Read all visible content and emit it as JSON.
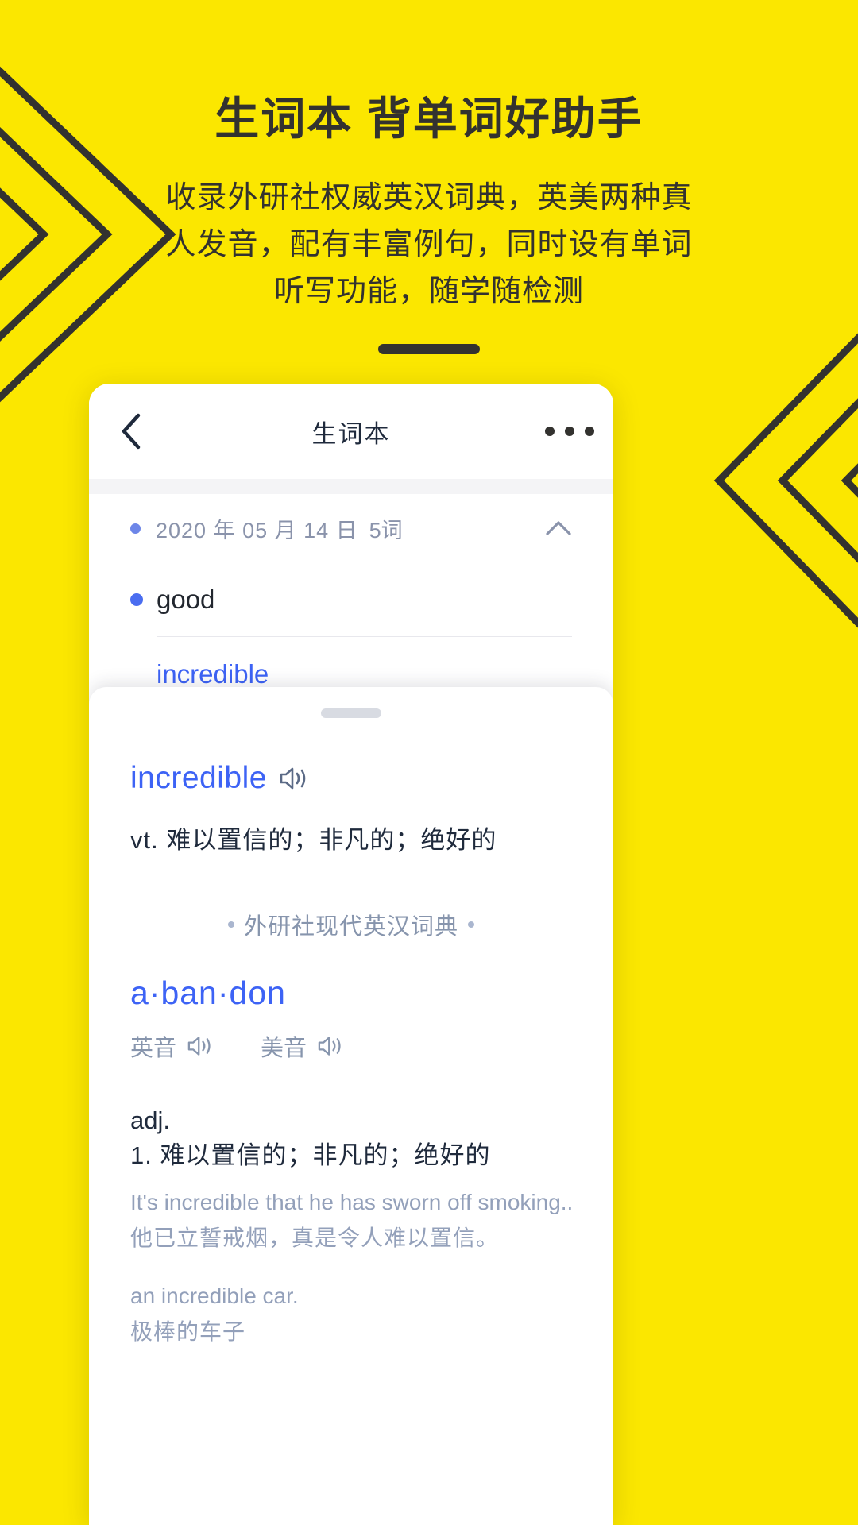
{
  "theme": {
    "bg_yellow": "#FBE700",
    "ink": "#33322f",
    "accent_blue": "#3d63f5",
    "muted_blue": "#93a0ba"
  },
  "promo": {
    "title": "生词本  背单词好助手",
    "subtitle": "收录外研社权威英汉词典，英美两种真人发音，配有丰富例句，同时设有单词听写功能，随学随检测"
  },
  "phone": {
    "nav": {
      "back_icon": "chevron-left-icon",
      "title": "生词本",
      "more_icon": "more-horizontal-icon"
    },
    "group": {
      "date": "2020 年 05 月 14 日",
      "count": "5词",
      "collapse_icon": "chevron-up-icon"
    },
    "words": [
      {
        "text": "good",
        "selected": false
      },
      {
        "text": "incredible",
        "selected": true
      }
    ],
    "sheet": {
      "grabber": "drag-handle",
      "entry": {
        "word": "incredible",
        "speaker_icon": "speaker-icon",
        "definition": "vt. 难以置信的；非凡的；绝好的"
      },
      "dictionary_name": "外研社现代英汉词典",
      "headword": "a·ban·don",
      "pronunciations": [
        {
          "label": "英音",
          "icon": "speaker-icon"
        },
        {
          "label": "美音",
          "icon": "speaker-icon"
        }
      ],
      "pos": "adj.",
      "sense": "1. 难以置信的；非凡的；绝好的",
      "examples": [
        {
          "en": "It's incredible that he has sworn off smoking..",
          "zh": "他已立誓戒烟，真是令人难以置信。"
        },
        {
          "en": "an incredible car.",
          "zh": "极棒的车子"
        }
      ]
    }
  }
}
